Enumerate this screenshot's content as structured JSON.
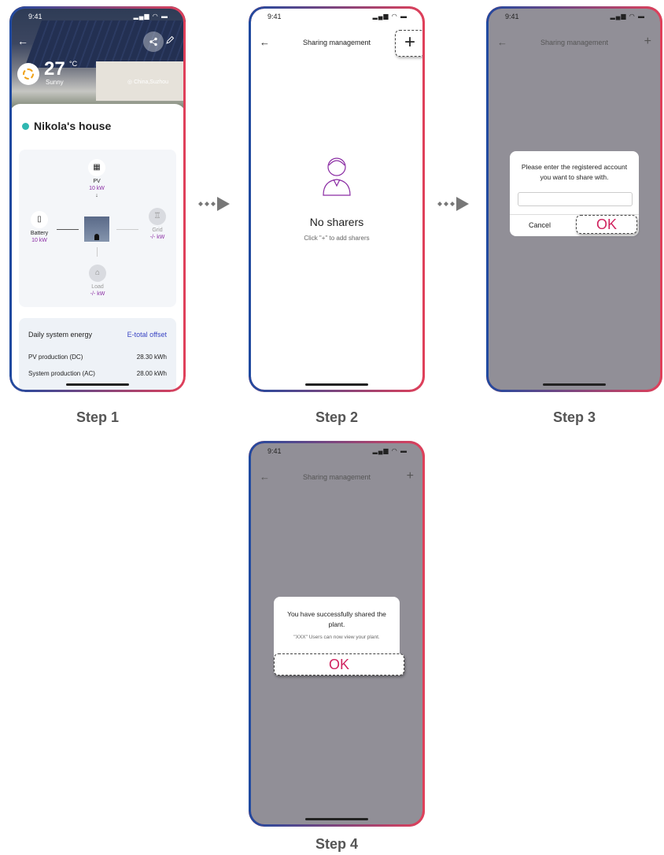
{
  "steps": [
    "Step 1",
    "Step 2",
    "Step 3",
    "Step 4"
  ],
  "status_time": "9:41",
  "status_icons": "▂▄▆ ◠ ▬",
  "icons": {
    "back": "←",
    "plus": "+",
    "share": "share-icon",
    "edit": "edit-icon",
    "arrow": "triple-dot-arrow-icon"
  },
  "colors": {
    "accent": "#d0245f",
    "link": "#3b46c4",
    "value": "#8a2ba3",
    "status_ok": "#2fb7b1",
    "overlay": "#918f97"
  },
  "step1": {
    "temperature": "27",
    "degree": "°C",
    "weather": "Sunny",
    "location": "China,Suzhou",
    "plant_name": "Nikola's house",
    "flow": {
      "pv": {
        "label": "PV",
        "value": "10 kW"
      },
      "battery": {
        "label": "Battery",
        "value": "10 kW"
      },
      "grid": {
        "label": "Grid",
        "value": "-/- kW"
      },
      "load": {
        "label": "Load",
        "value": "-/- kW"
      }
    },
    "energy": {
      "header": "Daily system energy",
      "link": "E-total offset",
      "rows": [
        {
          "label": "PV production (DC)",
          "value": "28.30 kWh"
        },
        {
          "label": "System production (AC)",
          "value": "28.00 kWh"
        }
      ]
    }
  },
  "sharing": {
    "title": "Sharing management",
    "empty_title": "No sharers",
    "empty_sub": "Click \"+\" to add sharers"
  },
  "dialog3": {
    "message": "Please enter the registered account you want to share with.",
    "input_value": "",
    "cancel": "Cancel",
    "ok": "OK"
  },
  "dialog4": {
    "title": "You have successfully shared the plant.",
    "message": "\"XXX\" Users can now view your plant.",
    "ok": "OK"
  }
}
